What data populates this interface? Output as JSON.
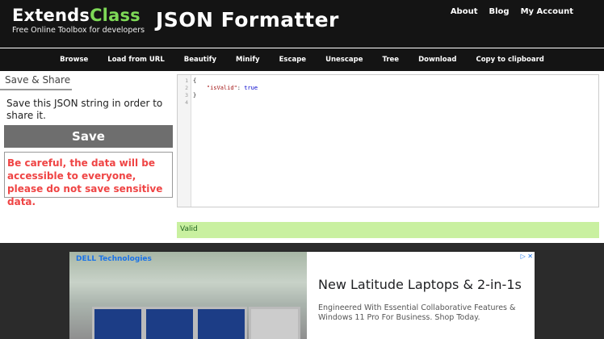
{
  "brand": {
    "name_part1": "Extends",
    "name_part2": "Class",
    "tagline": "Free Online Toolbox for developers"
  },
  "page": {
    "title": "JSON Formatter"
  },
  "top_nav": [
    "About",
    "Blog",
    "My Account"
  ],
  "toolbar": [
    "Browse",
    "Load from URL",
    "Beautify",
    "Minify",
    "Escape",
    "Unescape",
    "Tree",
    "Download",
    "Copy to clipboard"
  ],
  "share": {
    "tab_label": "Save & Share",
    "description": "Save this JSON string in order to share it.",
    "save_label": "Save",
    "warning": "Be careful, the data will be accessible to everyone, please do not save sensitive data."
  },
  "editor": {
    "line_numbers": [
      "1",
      "2",
      "3",
      "4"
    ],
    "lines": [
      "{",
      "    \"isValid\": true",
      "}",
      ""
    ]
  },
  "status": {
    "text": "Valid"
  },
  "ad": {
    "logo": "DELL Technologies",
    "title": "New Latitude Laptops & 2-in-1s",
    "subtitle": "Engineered With Essential Collaborative Features & Windows 11 Pro For Business. Shop Today.",
    "choices": "▷ ✕"
  },
  "colors": {
    "header_bg": "#141414",
    "accent": "#7ed957",
    "warning": "#ef4444",
    "valid_bg": "#c9f0a0"
  }
}
